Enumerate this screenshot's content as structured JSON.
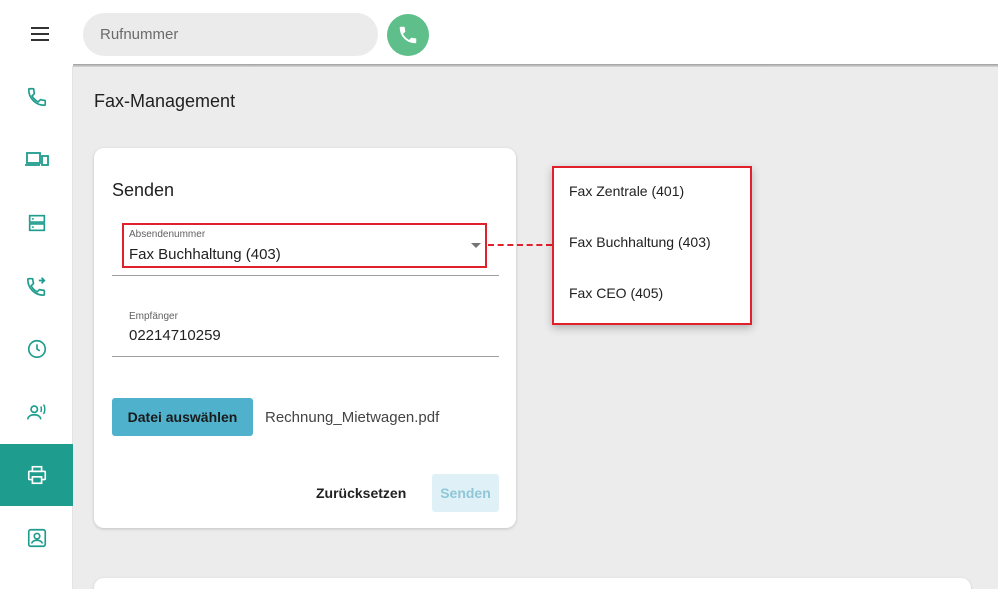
{
  "header": {
    "phone_placeholder": "Rufnummer",
    "icons": {
      "menu": "menu-icon",
      "call": "phone-icon"
    }
  },
  "sidebar": {
    "items": [
      {
        "icon": "phone-icon",
        "active": false
      },
      {
        "icon": "devices-icon",
        "active": false
      },
      {
        "icon": "server-icon",
        "active": false
      },
      {
        "icon": "call-forward-icon",
        "active": false
      },
      {
        "icon": "clock-icon",
        "active": false
      },
      {
        "icon": "voicemail-speaker-icon",
        "active": false
      },
      {
        "icon": "printer-icon",
        "active": true
      },
      {
        "icon": "contact-icon",
        "active": false
      }
    ]
  },
  "page": {
    "title": "Fax-Management"
  },
  "send_card": {
    "title": "Senden",
    "sender_label": "Absendenummer",
    "sender_value": "Fax Buchhaltung (403)",
    "recipient_label": "Empfänger",
    "recipient_value": "02214710259",
    "file_button": "Datei auswählen",
    "file_name": "Rechnung_Mietwagen.pdf",
    "reset_button": "Zurücksetzen",
    "send_button": "Senden"
  },
  "dropdown": {
    "options": [
      "Fax Zentrale (401)",
      "Fax Buchhaltung (403)",
      "Fax CEO (405)"
    ]
  },
  "colors": {
    "accent": "#1e9c8d",
    "call": "#5fbf8a",
    "button": "#4fb1cc",
    "highlight": "#e0202a"
  }
}
